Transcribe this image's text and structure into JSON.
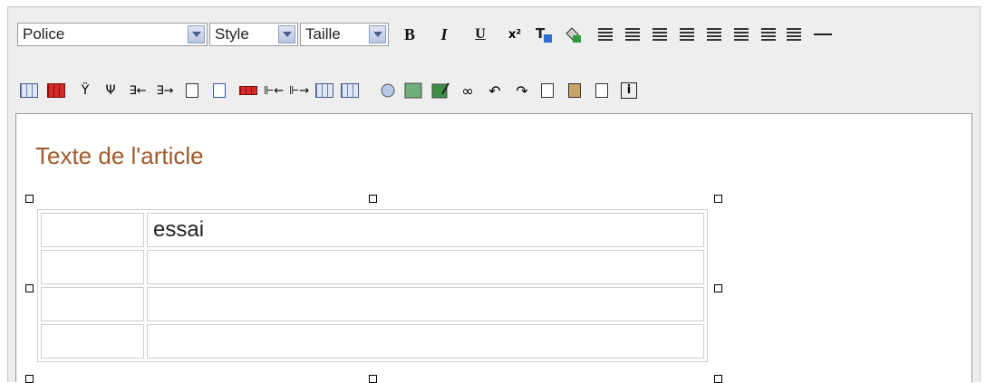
{
  "toolbar": {
    "font_select": "Police",
    "style_select": "Style",
    "size_select": "Taille",
    "bold": "B",
    "italic": "I",
    "underline": "U"
  },
  "editor": {
    "heading": "Texte de l'article",
    "table_rows": [
      [
        "",
        "essai"
      ],
      [
        "",
        ""
      ],
      [
        "",
        ""
      ],
      [
        "",
        ""
      ]
    ]
  }
}
